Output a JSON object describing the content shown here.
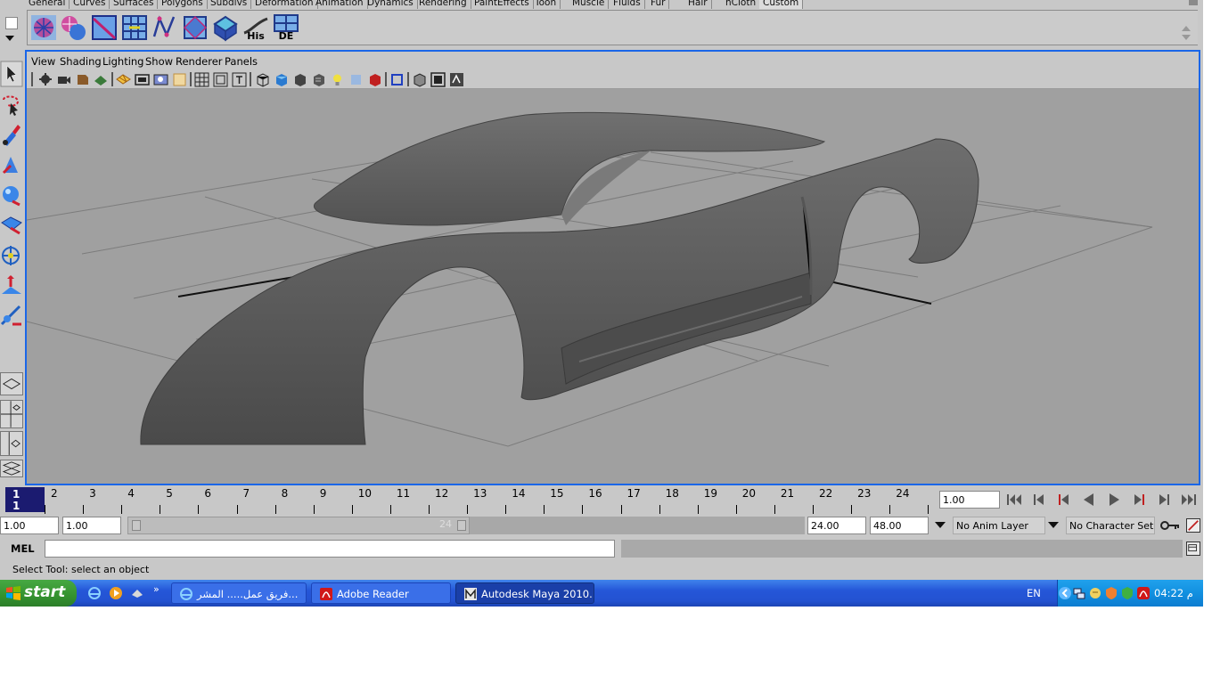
{
  "shelf_tabs": [
    "General",
    "Curves",
    "Surfaces",
    "Polygons",
    "Subdivs",
    "Deformation",
    "Animation",
    "Dynamics",
    "Rendering",
    "PaintEffects",
    "Toon",
    "Muscle",
    "Fluids",
    "Fur",
    "Hair",
    "nCloth",
    "Custom"
  ],
  "shelf_tab_active": "Custom",
  "shelf_button_labels": {
    "his": "His",
    "de": "DE"
  },
  "panel_menu": [
    "View",
    "Shading",
    "Lighting",
    "Show",
    "Renderer",
    "Panels"
  ],
  "time_slider": {
    "current_frame_top": "1",
    "current_frame_bottom": "1",
    "frame_labels": [
      "2",
      "3",
      "4",
      "5",
      "6",
      "7",
      "8",
      "9",
      "10",
      "11",
      "12",
      "13",
      "14",
      "15",
      "16",
      "17",
      "18",
      "19",
      "20",
      "21",
      "22",
      "23",
      "24"
    ],
    "current_time_field": "1.00"
  },
  "range_slider": {
    "start_time": "1.00",
    "playback_start": "1.00",
    "range_end_label": "24",
    "playback_end": "24.00",
    "end_time": "48.00",
    "anim_layer": "No Anim Layer",
    "character_set": "No Character Set"
  },
  "command_line": {
    "label": "MEL",
    "value": ""
  },
  "help_line": "Select Tool: select an object",
  "taskbar": {
    "start_label": "start",
    "tasks": [
      "فريق عمل..... المشر...",
      "Adobe Reader",
      "Autodesk Maya 2010..."
    ],
    "active_task_index": 2,
    "language": "EN",
    "clock": "04:22 م"
  },
  "colors": {
    "active_panel_border": "#1a66e8",
    "viewport_background": "#a0a0a0",
    "ui_background": "#c8c8c8",
    "current_frame_bg": "#1b1b70",
    "taskbar_blue": "#2352d1",
    "start_green": "#34922f"
  }
}
